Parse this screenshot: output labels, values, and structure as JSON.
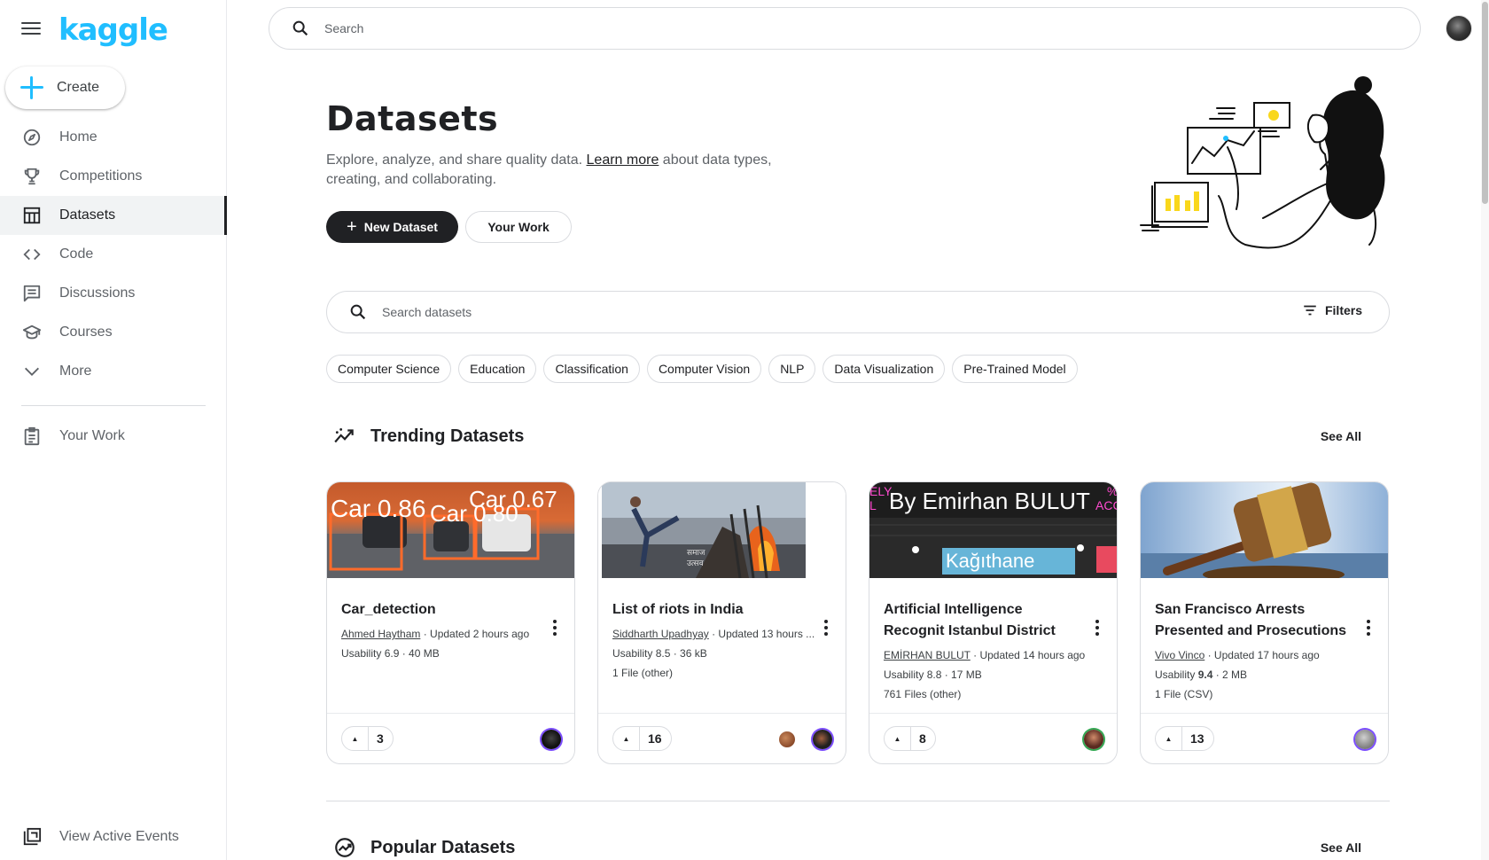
{
  "app": {
    "logo_text": "kaggle",
    "brand_color": "#20beff"
  },
  "sidebar": {
    "create_label": "Create",
    "items": [
      {
        "label": "Home",
        "icon": "compass-icon"
      },
      {
        "label": "Competitions",
        "icon": "trophy-icon"
      },
      {
        "label": "Datasets",
        "icon": "table-icon",
        "active": true
      },
      {
        "label": "Code",
        "icon": "code-icon"
      },
      {
        "label": "Discussions",
        "icon": "comment-icon"
      },
      {
        "label": "Courses",
        "icon": "school-icon"
      },
      {
        "label": "More",
        "icon": "chevron-down-icon"
      }
    ],
    "your_work": "Your Work",
    "view_active_events": "View Active Events"
  },
  "top_search": {
    "placeholder": "Search"
  },
  "header": {
    "title": "Datasets",
    "desc_before": "Explore, analyze, and share quality data. ",
    "desc_link": "Learn more",
    "desc_after": " about data types, creating, and collaborating.",
    "new_dataset": "New Dataset",
    "your_work": "Your Work"
  },
  "dataset_search": {
    "placeholder": "Search datasets",
    "filters_label": "Filters"
  },
  "chips": [
    "Computer Science",
    "Education",
    "Classification",
    "Computer Vision",
    "NLP",
    "Data Visualization",
    "Pre-Trained Model"
  ],
  "trending": {
    "title": "Trending Datasets",
    "see_all": "See All",
    "cards": [
      {
        "title": "Car_detection",
        "author": "Ahmed Haytham",
        "updated": " · Updated 2 hours ago",
        "usability_label": "Usability ",
        "usability": "6.9",
        "size": " · 40 MB",
        "files": "",
        "votes": "3",
        "thumb_texts": [
          "Car 0.86",
          "Car 0.67",
          "Car 0.80"
        ]
      },
      {
        "title": "List of riots in India",
        "author": "Siddharth Upadhyay",
        "updated": " · Updated 13 hours ...",
        "usability_label": "Usability ",
        "usability": "8.5",
        "size": " · 36 kB",
        "files": "1 File (other)",
        "votes": "16",
        "thumb_texts": [
          "समाज",
          "उत्सव"
        ]
      },
      {
        "title": "Artificial Intelligence Recognit Istanbul District",
        "author": "EMİRHAN BULUT",
        "updated": " · Updated 14 hours ago",
        "usability_label": "Usability ",
        "usability": "8.8",
        "size": " · 17 MB",
        "files": "761 Files (other)",
        "votes": "8",
        "thumb_texts": [
          "By Emirhan BULUT",
          "Kağıthane",
          "ELY",
          "L",
          "%",
          "ACC"
        ]
      },
      {
        "title": "San Francisco Arrests Presented and Prosecutions",
        "author": "Vivo Vinco",
        "updated": " · Updated 17 hours ago",
        "usability_label": "Usability ",
        "usability": "9.4",
        "size": " · 2 MB",
        "files": "1 File (CSV)",
        "votes": "13",
        "thumb_texts": []
      }
    ]
  },
  "popular": {
    "title": "Popular Datasets",
    "see_all": "See All"
  }
}
